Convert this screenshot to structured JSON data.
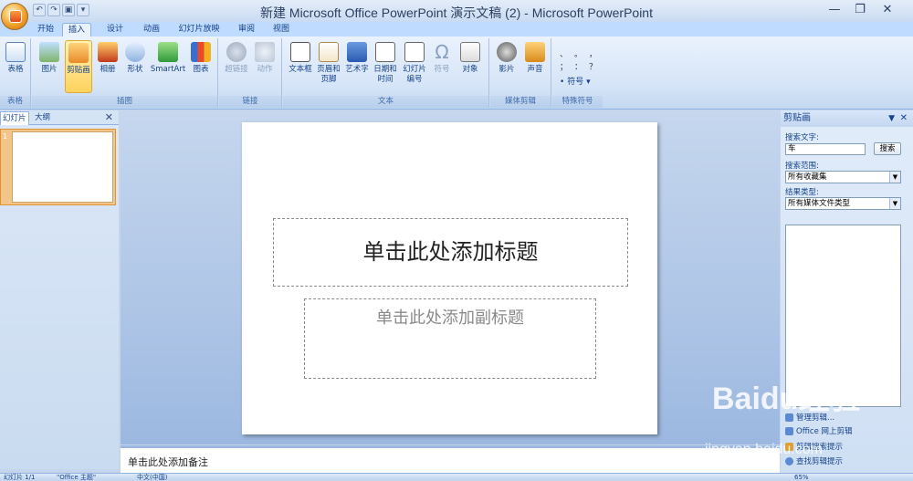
{
  "window": {
    "title": "新建 Microsoft Office PowerPoint 演示文稿 (2) - Microsoft PowerPoint",
    "minimize": "—",
    "restore": "❐",
    "close": "✕"
  },
  "qat": {
    "undo": "↶",
    "redo": "↷",
    "save": "▣"
  },
  "tabs": [
    "开始",
    "插入",
    "设计",
    "动画",
    "幻灯片放映",
    "审阅",
    "视图"
  ],
  "ribbon": {
    "groups": [
      "表格",
      "插图",
      "链接",
      "文本",
      "媒体剪辑",
      "特殊符号"
    ],
    "buttons": {
      "table": "表格",
      "picture": "图片",
      "clipart": "剪贴画",
      "album": "相册",
      "shapes": "形状",
      "smartart": "SmartArt",
      "chart": "图表",
      "hyperlink": "超链接",
      "action": "动作",
      "textbox": "文本框",
      "headerfooter": "页眉和页脚",
      "wordart": "艺术字",
      "datetime": "日期和时间",
      "slidenum": "幻灯片编号",
      "symbol": "符号",
      "object": "对象",
      "movie": "影片",
      "sound": "声音",
      "special_symbol": "符号"
    },
    "special_chars": [
      "、",
      "。",
      "，",
      "；",
      "：",
      "？"
    ]
  },
  "left_panel": {
    "tab_slides": "幻灯片",
    "tab_outline": "大纲",
    "close": "✕",
    "slide_number": "1"
  },
  "slide": {
    "title_placeholder": "单击此处添加标题",
    "subtitle_placeholder": "单击此处添加副标题"
  },
  "notes": {
    "placeholder": "单击此处添加备注"
  },
  "task_pane": {
    "title": "剪贴画",
    "search_label": "搜索文字:",
    "search_value": "车",
    "search_button": "搜索",
    "scope_label": "搜索范围:",
    "scope_value": "所有收藏集",
    "type_label": "结果类型:",
    "type_value": "所有媒体文件类型",
    "links": [
      "管理剪辑...",
      "Office 网上剪辑",
      "剪辑搜索提示",
      "查找剪辑提示"
    ]
  },
  "status": {
    "slide_info": "幻灯片 1/1",
    "theme": "\"Office 主题\"",
    "language": "中文(中国)",
    "zoom": "65%"
  },
  "watermark": {
    "brand": "Baidu经验",
    "url": "jingyan.baidu.com"
  }
}
